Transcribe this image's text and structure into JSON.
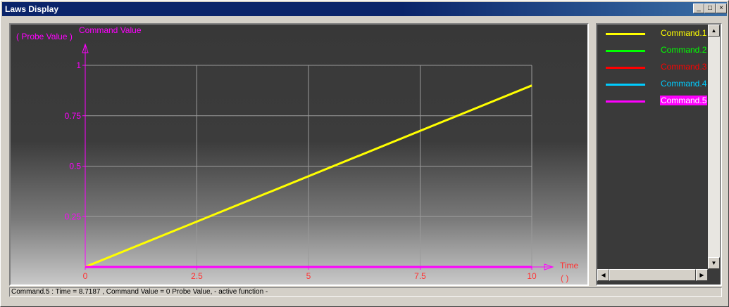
{
  "window": {
    "title": "Laws Display",
    "controls": {
      "minimize": "_",
      "maximize": "□",
      "close": "×"
    }
  },
  "chart_data": {
    "type": "line",
    "ytitle": "( Probe Value )",
    "ylabel": "Command Value",
    "xlabel": "Time",
    "xunit": "( )",
    "xlim": [
      0,
      10
    ],
    "ylim": [
      0,
      1
    ],
    "x_ticks": [
      "0",
      "2.5",
      "5",
      "7.5",
      "10"
    ],
    "x_tick_values": [
      0,
      2.5,
      5,
      7.5,
      10
    ],
    "y_ticks": [
      "0.25",
      "0.5",
      "0.75",
      "1"
    ],
    "y_tick_values": [
      0.25,
      0.5,
      0.75,
      1
    ],
    "grid": true,
    "series": [
      {
        "name": "Command.1",
        "color": "#ffff00",
        "x": [
          0,
          10
        ],
        "y": [
          0,
          0.9
        ]
      },
      {
        "name": "Command.5",
        "color": "#ff00ff",
        "x": [
          0,
          10
        ],
        "y": [
          0,
          0
        ]
      }
    ]
  },
  "legend": {
    "items": [
      {
        "label": "Command.1",
        "color": "#ffff00",
        "selected": false
      },
      {
        "label": "Command.2",
        "color": "#00ff00",
        "selected": false
      },
      {
        "label": "Command.3",
        "color": "#ff0000",
        "selected": false
      },
      {
        "label": "Command.4",
        "color": "#00ccff",
        "selected": false
      },
      {
        "label": "Command.5",
        "color": "#ff00ff",
        "selected": true
      }
    ]
  },
  "status": {
    "text": "Command.5 : Time = 8.7187 , Command Value = 0 Probe Value,  - active function -"
  },
  "colors": {
    "axis": "#ff00ff",
    "x_axis_labels": "#ff3333",
    "grid": "#9a9a9a",
    "title_bar": "#0a246a"
  }
}
